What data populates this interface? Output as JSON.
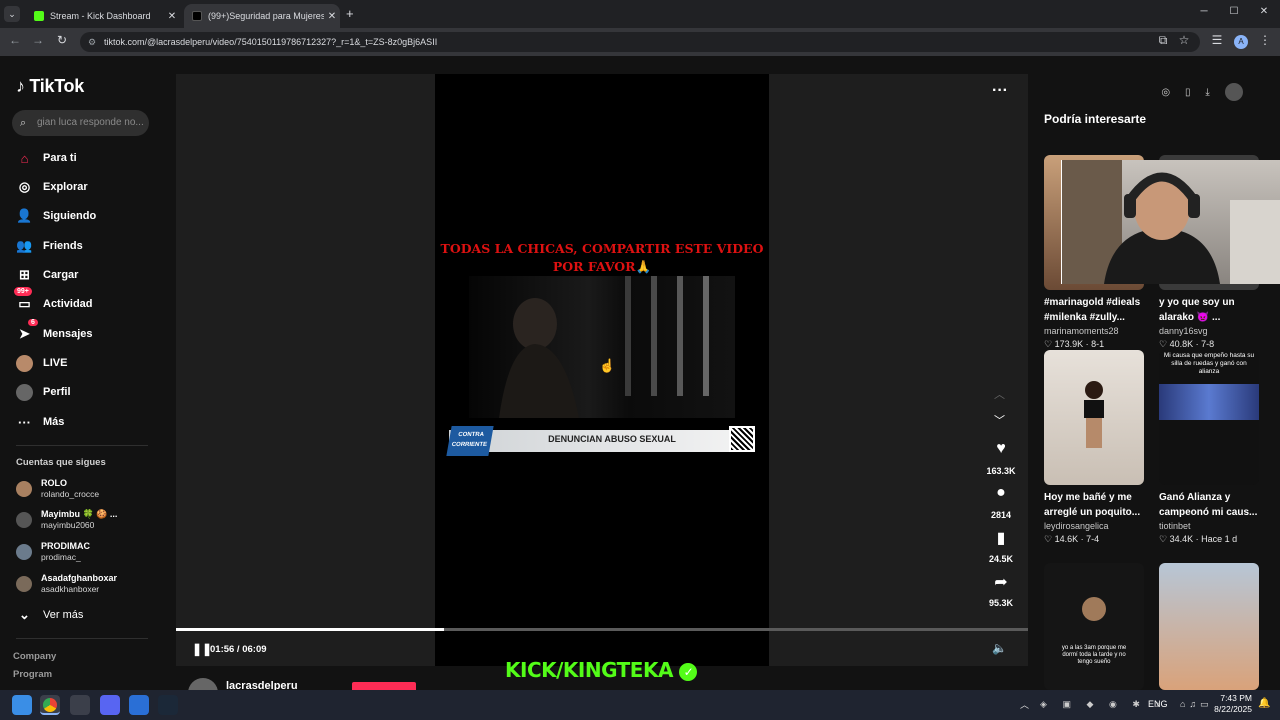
{
  "browser": {
    "tabs": [
      {
        "label": "Stream - Kick Dashboard",
        "close": "✕"
      },
      {
        "label": "(99+)Seguridad para Mujeres ...",
        "close": "✕"
      }
    ],
    "new_tab": "+",
    "url": "tiktok.com/@lacrasdelperu/video/7540150119786712327?_r=1&_t=ZS-8z0gBj6ASII",
    "window_controls": [
      "─",
      "☐",
      "✕"
    ]
  },
  "sidebar": {
    "logo": "TikTok",
    "search_placeholder": "gian luca responde no...",
    "nav": [
      {
        "label": "Para ti",
        "icon": "home-icon"
      },
      {
        "label": "Explorar",
        "icon": "compass-icon"
      },
      {
        "label": "Siguiendo",
        "icon": "following-icon"
      },
      {
        "label": "Friends",
        "icon": "friends-icon"
      },
      {
        "label": "Cargar",
        "icon": "upload-icon"
      },
      {
        "label": "Actividad",
        "icon": "activity-icon",
        "badge": "99+"
      },
      {
        "label": "Mensajes",
        "icon": "messages-icon",
        "badge": "6"
      },
      {
        "label": "LIVE",
        "icon": "live-icon"
      },
      {
        "label": "Perfil",
        "icon": "profile-icon"
      },
      {
        "label": "Más",
        "icon": "more-icon"
      }
    ],
    "following_title": "Cuentas que sigues",
    "following": [
      {
        "name": "ROLO",
        "handle": "rolando_crocce"
      },
      {
        "name": "Mayimbu 🍀 🍪 ...",
        "handle": "mayimbu2060"
      },
      {
        "name": "PRODIMAC",
        "handle": "prodimac_"
      },
      {
        "name": "Asadafghanboxar",
        "handle": "asadkhanboxer"
      }
    ],
    "see_more": "Ver más",
    "footer": [
      "Company",
      "Program"
    ]
  },
  "video": {
    "caption_line1": "TODAS LA CHICAS, COMPARTIR ESTE VIDEO",
    "caption_line2": "POR FAVOR🙏",
    "banner_logo1": "CONTRA",
    "banner_logo2": "CORRIENTE",
    "banner_text": "DENUNCIAN ABUSO SEXUAL",
    "time": "01:56 / 06:09",
    "progress": 0.314,
    "author": "lacrasdelperu"
  },
  "actions": {
    "likes": "163.3K",
    "comments": "2814",
    "saves": "24.5K",
    "shares": "95.3K"
  },
  "recs": {
    "title": "Podría interesarte",
    "items": [
      {
        "caption": "#marinagold #dieals #milenka #zully...",
        "author": "marinamoments28",
        "stats": "♡ 173.9K · 8-1"
      },
      {
        "caption": "y yo que soy un alarako 👿 ...",
        "author": "danny16svg",
        "stats": "♡ 40.8K · 7-8"
      },
      {
        "caption": "Hoy me bañé y me arreglé un poquito...",
        "author": "leydirosangelica",
        "stats": "♡ 14.6K · 7-4"
      },
      {
        "caption": "Ganó Alianza y campeonó mi caus...",
        "author": "tiotinbet",
        "stats": "♡ 34.4K · Hace 1 d"
      },
      {
        "caption": "",
        "author": "",
        "stats": ""
      },
      {
        "caption": "",
        "author": "",
        "stats": ""
      }
    ],
    "thumb2_text": "Mi causa que empeño hasta su silla de ruedas y ganó con alianza",
    "thumb5_text": "yo a las 3am porque me dormí toda la tarde y no tengo sueño"
  },
  "overlay": {
    "brand": "KICK/KINGTEKA"
  },
  "taskbar": {
    "lang": "ENG",
    "time": "7:43 PM",
    "date": "8/22/2025"
  }
}
